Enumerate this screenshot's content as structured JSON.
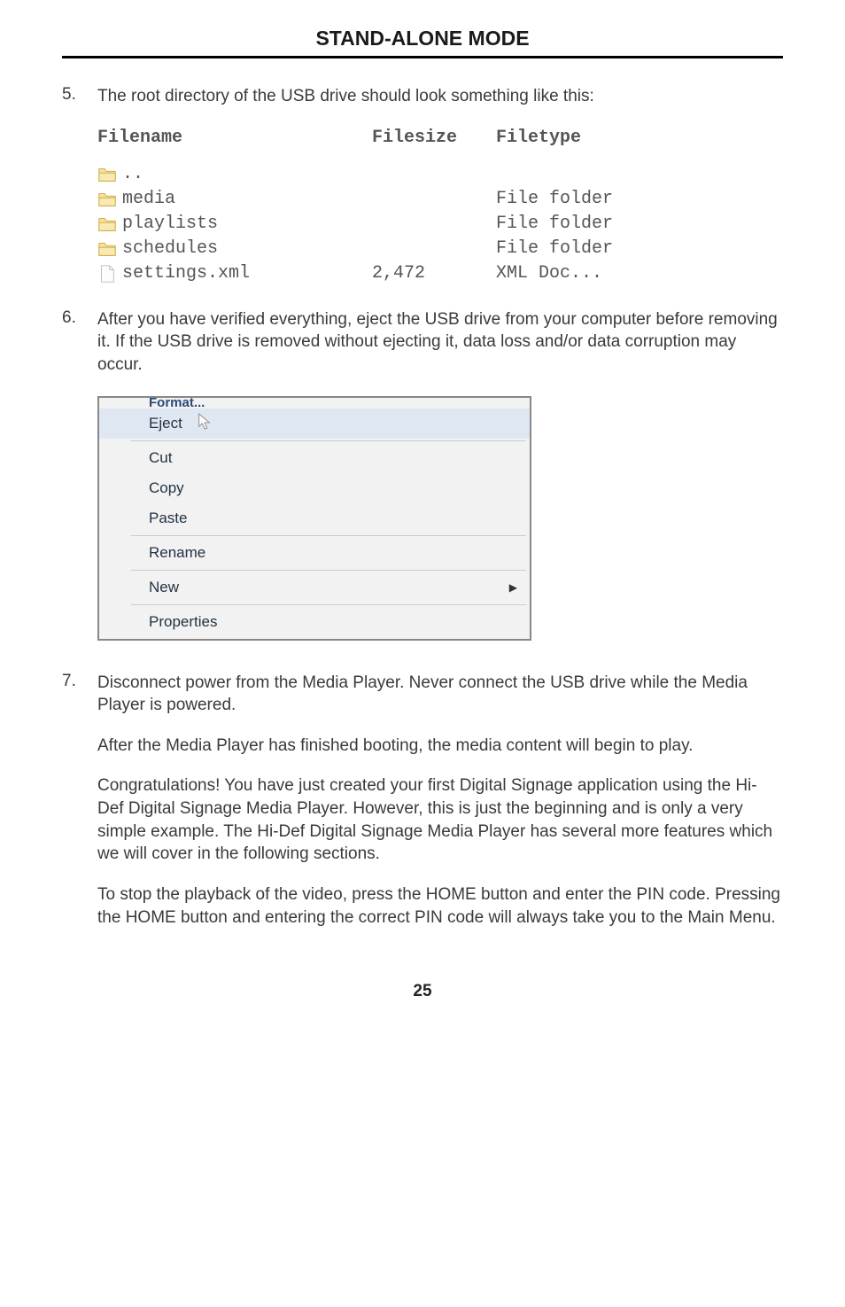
{
  "page_title": "STAND-ALONE MODE",
  "step5": {
    "num": "5.",
    "text": "The root directory of the USB drive should look something like this:",
    "headers": {
      "name": "Filename",
      "size": "Filesize",
      "type": "Filetype"
    },
    "rows": [
      {
        "name": "..",
        "size": "",
        "type": "",
        "icon": "folder"
      },
      {
        "name": "media",
        "size": "",
        "type": "File folder",
        "icon": "folder"
      },
      {
        "name": "playlists",
        "size": "",
        "type": "File folder",
        "icon": "folder"
      },
      {
        "name": "schedules",
        "size": "",
        "type": "File folder",
        "icon": "folder"
      },
      {
        "name": "settings.xml",
        "size": "2,472",
        "type": "XML Doc...",
        "icon": "file"
      }
    ]
  },
  "step6": {
    "num": "6.",
    "text": "After you have verified everything, eject the USB drive from your computer before removing it.  If the USB drive is removed without ejecting it, data loss and/or data corruption may occur."
  },
  "context_menu": {
    "format": "Format...",
    "eject": "Eject",
    "cut": "Cut",
    "copy": "Copy",
    "paste": "Paste",
    "rename": "Rename",
    "new": "New",
    "properties": "Properties"
  },
  "step7": {
    "num": "7.",
    "p1": "Disconnect power from the Media Player.  Never connect the USB drive while the Media Player is powered.",
    "p2": "After the Media Player has finished booting, the media content will begin to play.",
    "p3": "Congratulations!  You have just created your first Digital Signage application using the Hi-Def Digital Signage Media Player.  However, this is just the beginning and is only a very simple example.  The Hi-Def Digital Signage Media Player has several more features which we will cover in the following sections.",
    "p4": "To stop the playback of the video, press the HOME button and enter the PIN code.  Pressing the HOME button and entering the correct PIN code will always take you to the Main Menu."
  },
  "page_number": "25"
}
